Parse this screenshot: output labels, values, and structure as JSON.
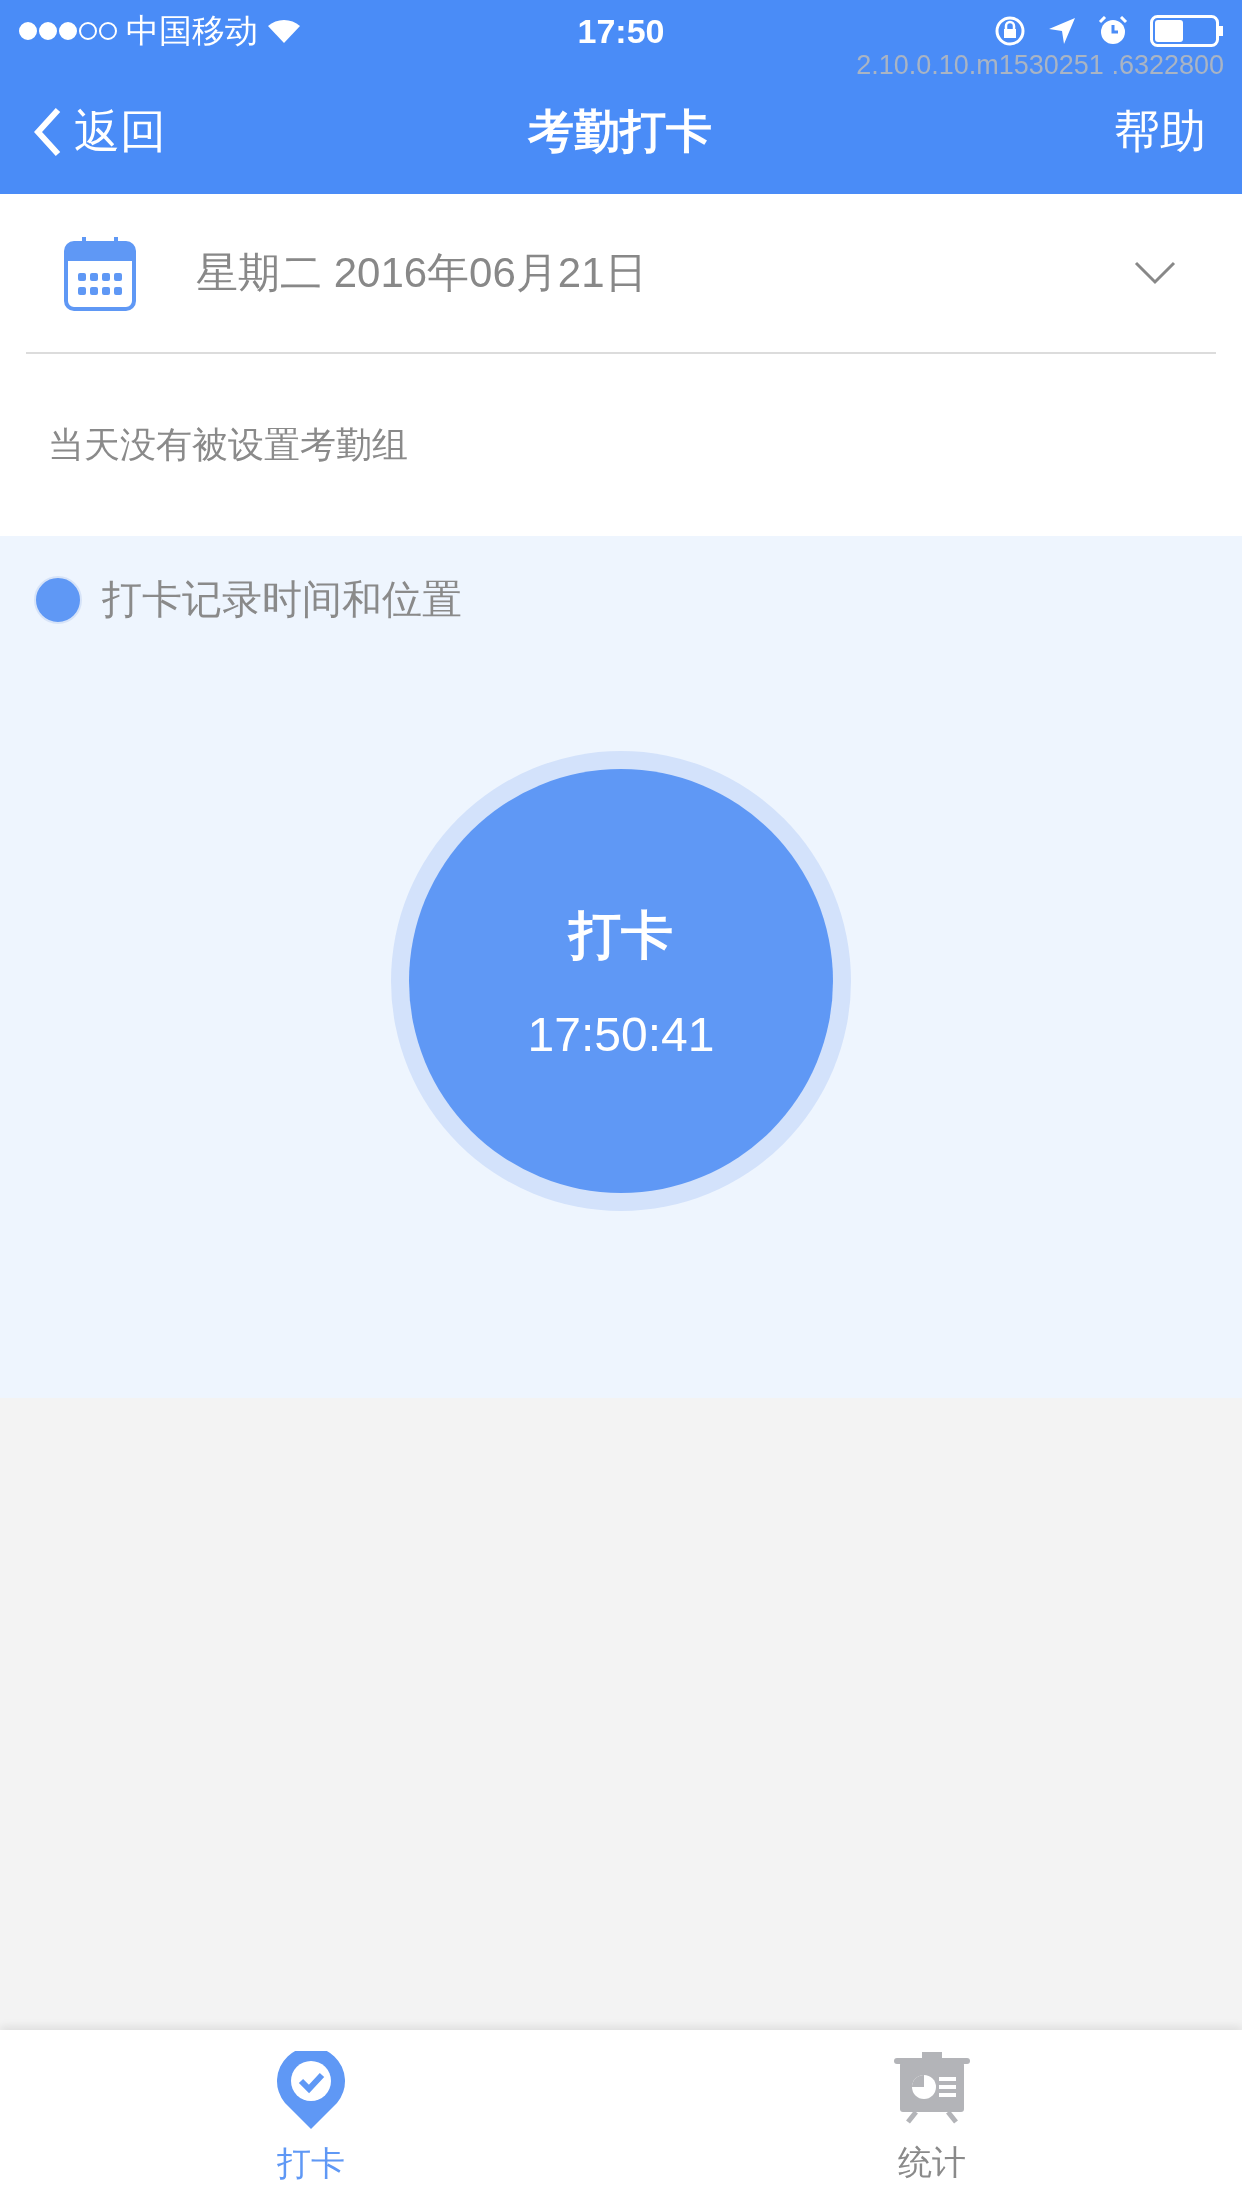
{
  "status_bar": {
    "carrier": "中国移动",
    "time": "17:50"
  },
  "version": "2.10.0.10.m1530251 .6322800",
  "nav_bar": {
    "back": "返回",
    "title": "考勤打卡",
    "help": "帮助"
  },
  "date_picker": {
    "value": "星期二 2016年06月21日"
  },
  "notice": "当天没有被设置考勤组",
  "punch": {
    "legend": "打卡记录时间和位置",
    "button_label": "打卡",
    "time": "17:50:41"
  },
  "tabs": [
    {
      "label": "打卡",
      "kind": "punch",
      "selected": true
    },
    {
      "label": "统计",
      "kind": "stats",
      "selected": false
    }
  ]
}
